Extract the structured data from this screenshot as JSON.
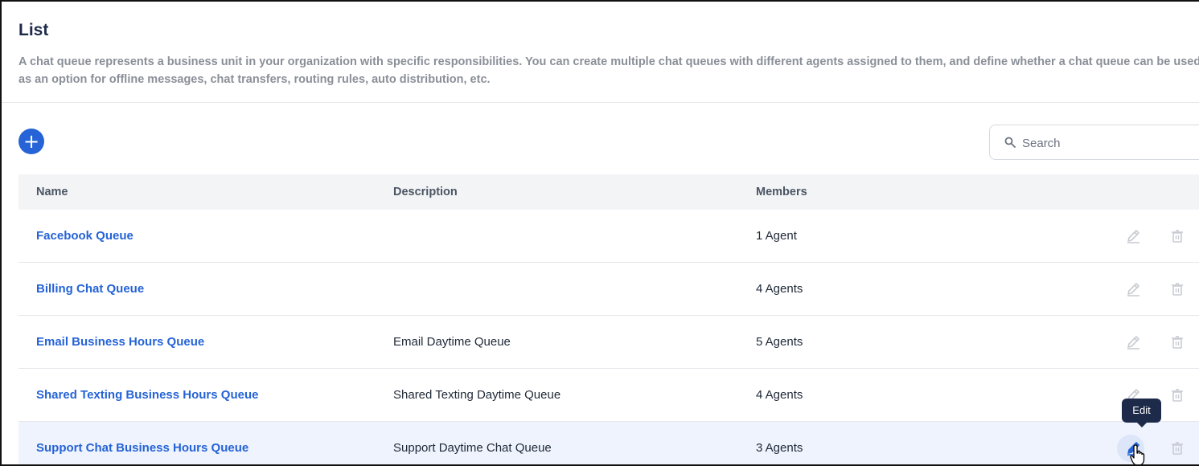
{
  "header": {
    "title": "List",
    "description": "A chat queue represents a business unit in your organization with specific responsibilities. You can create multiple chat queues with different agents assigned to them, and define whether a chat queue can be used as an option for offline messages, chat transfers, routing rules, auto distribution, etc."
  },
  "toolbar": {
    "add_label": "+",
    "search_placeholder": "Search"
  },
  "table": {
    "columns": [
      "Name",
      "Description",
      "Members"
    ],
    "rows": [
      {
        "name": "Facebook Queue",
        "description": "",
        "members": "1 Agent"
      },
      {
        "name": "Billing Chat Queue",
        "description": "",
        "members": "4 Agents"
      },
      {
        "name": "Email Business Hours Queue",
        "description": "Email Daytime Queue",
        "members": "5 Agents"
      },
      {
        "name": "Shared Texting Business Hours Queue",
        "description": "Shared Texting Daytime Queue",
        "members": "4 Agents"
      },
      {
        "name": "Support Chat Business Hours Queue",
        "description": "Support Daytime Chat Queue",
        "members": "3 Agents"
      }
    ]
  },
  "tooltip": {
    "label": "Edit"
  },
  "colors": {
    "accent": "#2563d6",
    "title": "#1e2a4a",
    "hover_row": "#eef3fd"
  }
}
